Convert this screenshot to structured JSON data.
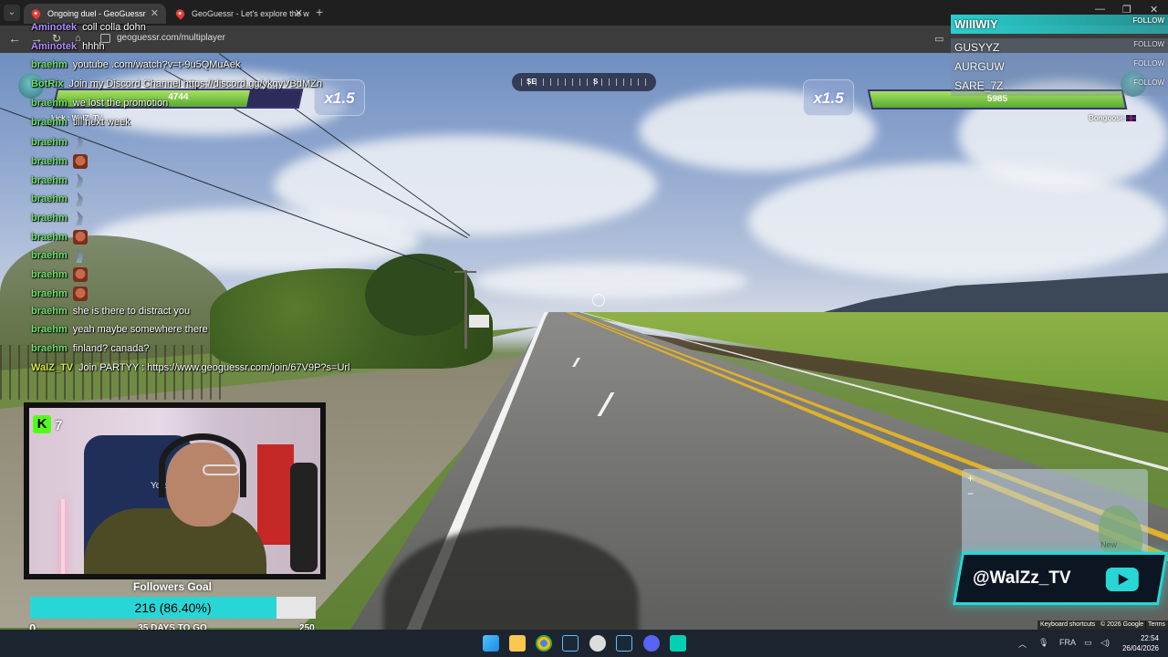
{
  "browser": {
    "tabs": [
      {
        "label": "Ongoing duel - GeoGuessr",
        "active": true
      },
      {
        "label": "GeoGuessr - Let's explore the w",
        "active": false
      }
    ],
    "url": "geoguessr.com/multiplayer"
  },
  "hud": {
    "compass": {
      "left": "SE",
      "center": "S"
    },
    "left_player": {
      "health": "4744",
      "health_fraction": 0.79,
      "name": "kick : WalZ_TV"
    },
    "right_player": {
      "health": "5985",
      "health_fraction": 1.0,
      "name": "Bongoose"
    },
    "multiplier_left": "x1.5",
    "multiplier_right": "x1.5"
  },
  "chat": [
    {
      "user": "Aminotek",
      "color": "#b38bff",
      "text": "coll colla dohn"
    },
    {
      "user": "Aminotek",
      "color": "#b38bff",
      "text": "hhhh"
    },
    {
      "user": "braehm",
      "color": "#6ee06e",
      "text": "youtube .com/watch?v=t-9u5QMuAek"
    },
    {
      "user": "BotRix",
      "color": "#6ee06e",
      "text": "Join my Discord Channel https://discord.gg/ykqyVBdMZn"
    },
    {
      "user": "braehm",
      "color": "#6ee06e",
      "text": "we lost the promotion"
    },
    {
      "user": "braehm",
      "color": "#6ee06e",
      "text": "till next week"
    },
    {
      "user": "braehm",
      "color": "#6ee06e",
      "text": "",
      "emote": "hat"
    },
    {
      "user": "braehm",
      "color": "#6ee06e",
      "text": "",
      "emote": "face"
    },
    {
      "user": "braehm",
      "color": "#6ee06e",
      "text": "",
      "emote": "hat"
    },
    {
      "user": "braehm",
      "color": "#6ee06e",
      "text": "",
      "emote": "hat"
    },
    {
      "user": "braehm",
      "color": "#6ee06e",
      "text": "",
      "emote": "hat"
    },
    {
      "user": "braehm",
      "color": "#6ee06e",
      "text": "",
      "emote": "face"
    },
    {
      "user": "braehm",
      "color": "#6ee06e",
      "text": "",
      "emote": "hat"
    },
    {
      "user": "braehm",
      "color": "#6ee06e",
      "text": "",
      "emote": "face"
    },
    {
      "user": "braehm",
      "color": "#6ee06e",
      "text": "",
      "emote": "face"
    },
    {
      "user": "braehm",
      "color": "#6ee06e",
      "text": "she is there to distract you"
    },
    {
      "user": "braehm",
      "color": "#6ee06e",
      "text": "yeah maybe somewhere there"
    },
    {
      "user": "braehm",
      "color": "#6ee06e",
      "text": "finland? canada?"
    },
    {
      "user": "WalZ_TV",
      "color": "#d7e84a",
      "text": "Join PARTYY : https://www.geoguessr.com/join/67V9P?s=Url"
    }
  ],
  "webcam": {
    "kick_count": "7",
    "chair_label": "Yole"
  },
  "followers_goal": {
    "title": "Followers Goal",
    "progress_text": "216 (86.40%)",
    "fraction": 0.864,
    "min": "0",
    "max": "250",
    "days_left": "35 DAYS TO GO"
  },
  "follow_list": [
    {
      "name": "WIIIWIY",
      "action": "FOLLOW"
    },
    {
      "name": "GUSYYZ",
      "action": "FOLLOW"
    },
    {
      "name": "AURGUW",
      "action": "FOLLOW"
    },
    {
      "name": "SARE_7Z",
      "action": "FOLLOW"
    }
  ],
  "social": {
    "handle": "@WalZz_TV",
    "icon": "youtube-icon"
  },
  "map_footer": {
    "shortcuts": "Keyboard shortcuts",
    "copyright": "© 2026 Google",
    "terms": "Terms",
    "minimap_label": "New"
  },
  "taskbar": {
    "lang": "FRA",
    "time": "22:54",
    "date": "26/04/2026"
  },
  "colors": {
    "accent": "#29d6d6",
    "health": "#56ab2f",
    "kick": "#53fc18"
  }
}
